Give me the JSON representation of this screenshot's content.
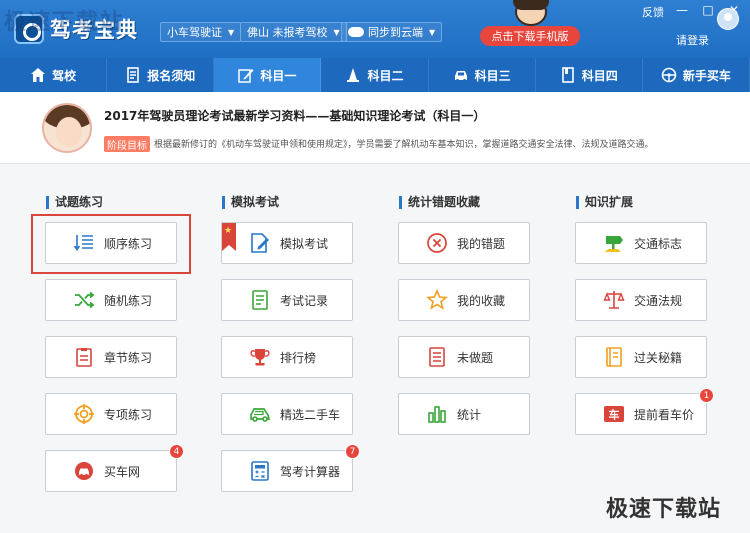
{
  "app": {
    "title": "驾考宝典",
    "watermark_top": "极速下载站",
    "watermark_bottom": "极速下载站"
  },
  "header": {
    "license_type": "小车驾驶证",
    "location": "佛山 未报考驾校",
    "sync": "同步到云端",
    "download_mobile": "点击下载手机版",
    "feedback": "反馈",
    "login": "请登录",
    "window_controls": [
      "—",
      "□",
      "✕"
    ]
  },
  "nav": {
    "items": [
      {
        "label": "驾校",
        "icon": "home-icon"
      },
      {
        "label": "报名须知",
        "icon": "document-icon"
      },
      {
        "label": "科目一",
        "icon": "edit-icon"
      },
      {
        "label": "科目二",
        "icon": "cone-icon"
      },
      {
        "label": "科目三",
        "icon": "car-icon"
      },
      {
        "label": "科目四",
        "icon": "book-icon"
      },
      {
        "label": "新手买车",
        "icon": "steering-wheel-icon"
      }
    ],
    "active_index": 2
  },
  "banner": {
    "title": "2017年驾驶员理论考试最新学习资料——基础知识理论考试（科目一）",
    "goal_label": "阶段目标",
    "description": "根据最新修订的《机动车驾驶证申领和使用规定》，学员需要了解机动车基本知识，掌握道路交通安全法律、法规及道路交通。"
  },
  "columns": [
    {
      "title": "试题练习",
      "buttons": [
        {
          "label": "顺序练习",
          "icon": "list-order-icon",
          "highlighted": true
        },
        {
          "label": "随机练习",
          "icon": "shuffle-icon"
        },
        {
          "label": "章节练习",
          "icon": "chapter-icon"
        },
        {
          "label": "专项练习",
          "icon": "target-icon"
        },
        {
          "label": "买车网",
          "icon": "car-search-icon",
          "badge": "4"
        }
      ]
    },
    {
      "title": "模拟考试",
      "buttons": [
        {
          "label": "模拟考试",
          "icon": "exam-edit-icon"
        },
        {
          "label": "考试记录",
          "icon": "record-icon"
        },
        {
          "label": "排行榜",
          "icon": "trophy-icon"
        },
        {
          "label": "精选二手车",
          "icon": "used-car-icon"
        },
        {
          "label": "驾考计算器",
          "icon": "calculator-icon",
          "badge": "7"
        }
      ]
    },
    {
      "title": "统计错题收藏",
      "buttons": [
        {
          "label": "我的错题",
          "icon": "wrong-icon"
        },
        {
          "label": "我的收藏",
          "icon": "star-icon"
        },
        {
          "label": "未做题",
          "icon": "undone-icon"
        },
        {
          "label": "统计",
          "icon": "bar-chart-icon"
        }
      ]
    },
    {
      "title": "知识扩展",
      "buttons": [
        {
          "label": "交通标志",
          "icon": "traffic-sign-icon"
        },
        {
          "label": "交通法规",
          "icon": "scales-icon"
        },
        {
          "label": "过关秘籍",
          "icon": "guide-book-icon"
        },
        {
          "label": "提前看车价",
          "icon": "car-price-icon",
          "badge": "1"
        }
      ]
    }
  ],
  "colors": {
    "header_blue": "#1f6fc4",
    "nav_active": "#2f86dc",
    "accent_red": "#e8453c",
    "icon_green": "#3aa63a",
    "icon_orange": "#f0a020",
    "icon_red": "#d9443b",
    "icon_blue": "#2a76c9"
  }
}
